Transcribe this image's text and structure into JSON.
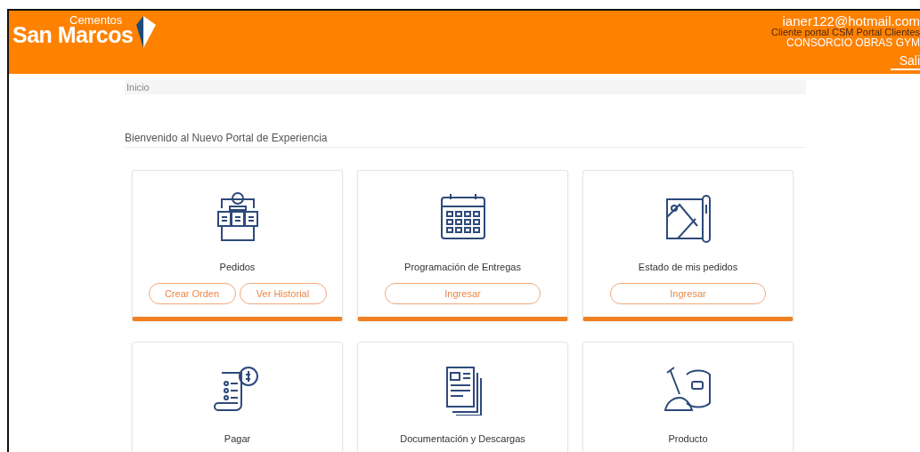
{
  "header": {
    "logo": {
      "tagline": "Cementos",
      "name": "San Marcos"
    },
    "user": {
      "email": "ianer122@hotmail.com",
      "role": "Cliente portal CSM Portal Clientes",
      "company": "CONSORCIO OBRAS GYM"
    },
    "logout": "Sali"
  },
  "breadcrumb": "Inicio",
  "welcome": "Bienvenido al Nuevo Portal de Experiencia",
  "cards": [
    {
      "title": "Pedidos",
      "buttons": [
        "Crear Orden",
        "Ver Historial"
      ]
    },
    {
      "title": "Programación de Entregas",
      "buttons": [
        "Ingresar"
      ]
    },
    {
      "title": "Estado de mis pedidos",
      "buttons": [
        "Ingresar"
      ]
    },
    {
      "title": "Pagar"
    },
    {
      "title": "Documentación y Descargas"
    },
    {
      "title": "Producto"
    }
  ]
}
